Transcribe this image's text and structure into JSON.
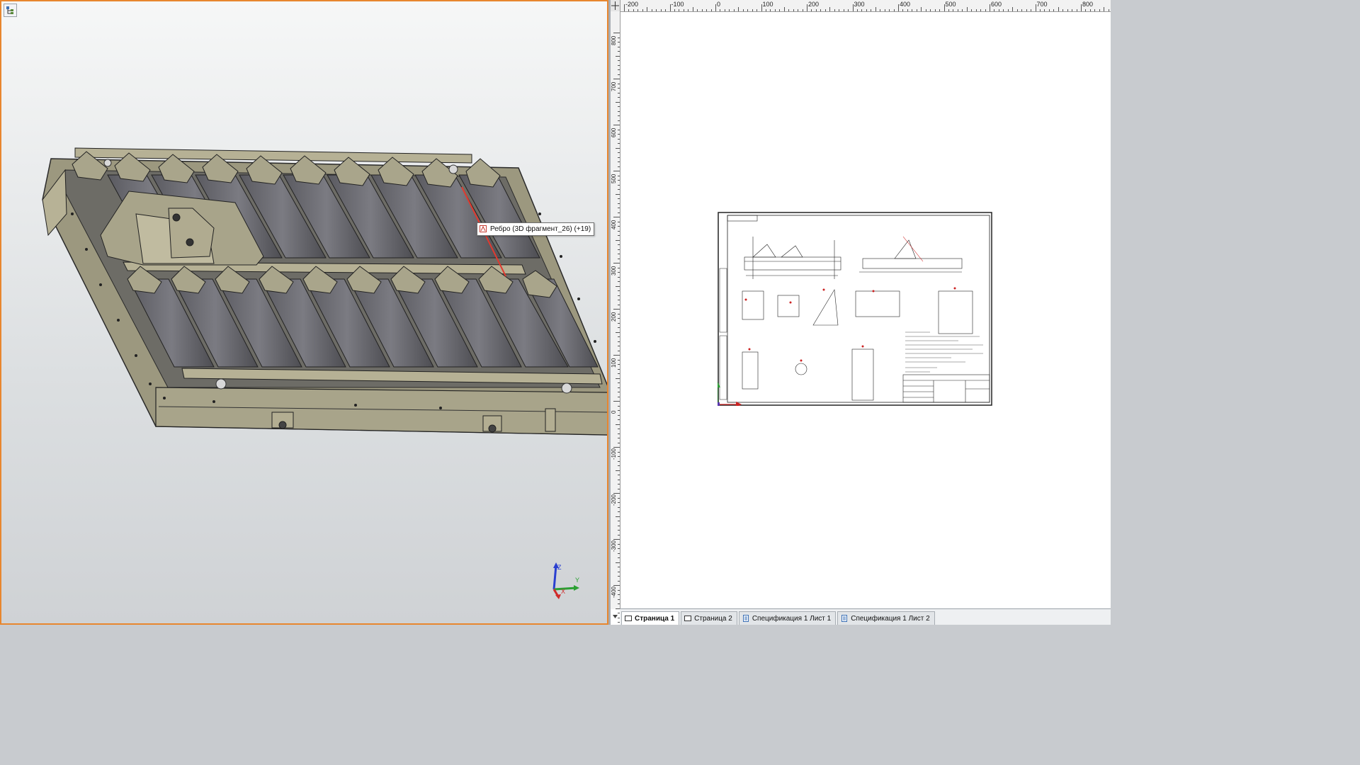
{
  "viewport3d": {
    "tooltip_text": "Ребро (3D фрагмент_26) (+19)",
    "accent_color": "#e8862e",
    "model_color": "#8e8a74",
    "triad": {
      "x": "X",
      "y": "Y",
      "z": "Z"
    }
  },
  "ruler": {
    "horizontal": [
      "-200",
      "-100",
      "0",
      "100",
      "200",
      "300",
      "400",
      "500",
      "600",
      "700",
      "800"
    ],
    "vertical": [
      "800",
      "700",
      "600",
      "500",
      "400",
      "300",
      "200",
      "100",
      "0",
      "-100",
      "-200",
      "-300",
      "-400"
    ]
  },
  "tabs": [
    {
      "label": "Страница 1",
      "icon": "page-icon",
      "active": true
    },
    {
      "label": "Страница 2",
      "icon": "page-icon",
      "active": false
    },
    {
      "label": "Спецификация 1 Лист 1",
      "icon": "spec-icon",
      "active": false
    },
    {
      "label": "Спецификация 1 Лист 2",
      "icon": "spec-icon",
      "active": false
    }
  ]
}
